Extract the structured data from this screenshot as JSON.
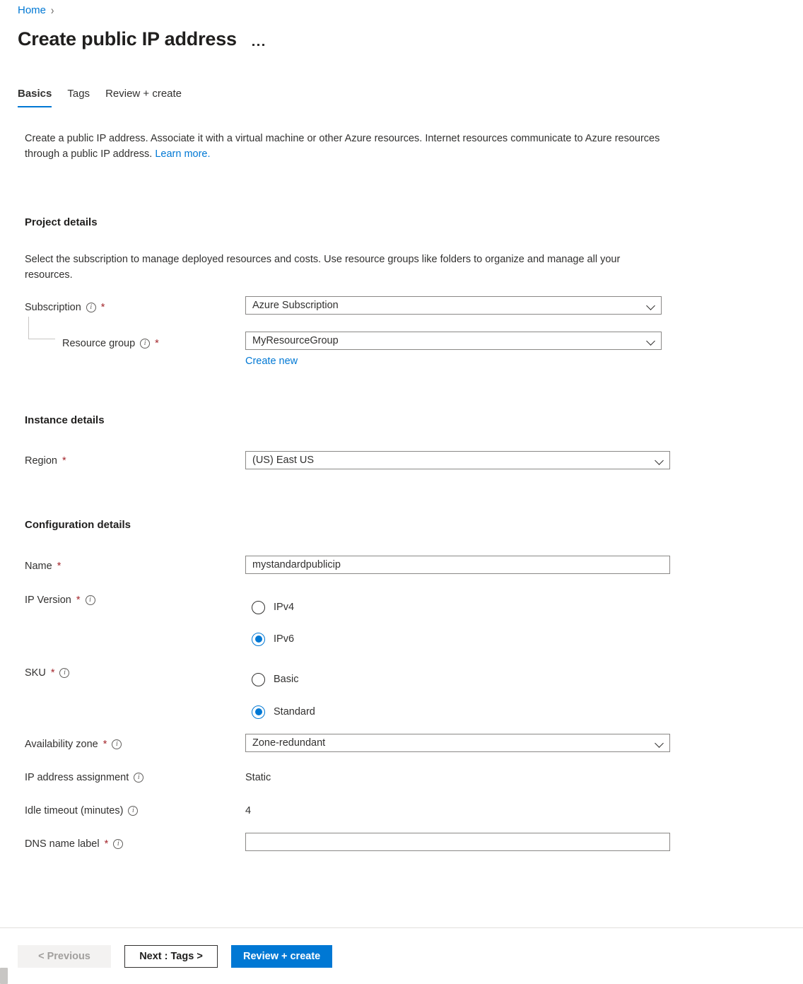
{
  "breadcrumb": {
    "home": "Home",
    "separator": "›"
  },
  "header": {
    "title": "Create public IP address",
    "more_menu": "more-options"
  },
  "tabs": [
    {
      "label": "Basics",
      "active": true
    },
    {
      "label": "Tags",
      "active": false
    },
    {
      "label": "Review + create",
      "active": false
    }
  ],
  "intro": {
    "text": "Create a public IP address. Associate it with a virtual machine or other Azure resources. Internet resources communicate to Azure resources through a public IP address. ",
    "link": "Learn more."
  },
  "project_details": {
    "heading": "Project details",
    "description": "Select the subscription to manage deployed resources and costs. Use resource groups like folders to organize and manage all your resources.",
    "subscription": {
      "label": "Subscription",
      "required": "*",
      "value": "Azure Subscription"
    },
    "resource_group": {
      "label": "Resource group",
      "required": "*",
      "value": "MyResourceGroup",
      "create_new": "Create new"
    }
  },
  "instance_details": {
    "heading": "Instance details",
    "region": {
      "label": "Region",
      "required": "*",
      "value": "(US) East US"
    }
  },
  "configuration_details": {
    "heading": "Configuration details",
    "name": {
      "label": "Name",
      "required": "*",
      "value": "mystandardpublicip",
      "placeholder": ""
    },
    "ip_version": {
      "label": "IP Version",
      "required": "*",
      "options": [
        {
          "label": "IPv4",
          "selected": false
        },
        {
          "label": "IPv6",
          "selected": true
        }
      ]
    },
    "sku": {
      "label": "SKU",
      "required": "*",
      "options": [
        {
          "label": "Basic",
          "selected": false
        },
        {
          "label": "Standard",
          "selected": true
        }
      ]
    },
    "availability_zone": {
      "label": "Availability zone",
      "required": "*",
      "value": "Zone-redundant"
    },
    "ip_address_assignment": {
      "label": "IP address assignment",
      "value": "Static"
    },
    "idle_timeout": {
      "label": "Idle timeout (minutes)",
      "value": "4"
    },
    "dns_name_label": {
      "label": "DNS name label",
      "required": "*",
      "value": "",
      "placeholder": ""
    }
  },
  "footer": {
    "previous": "< Previous",
    "next": "Next : Tags >",
    "review_create": "Review + create"
  },
  "icons": {
    "info": "i",
    "chevron_down": "chevron-down-icon"
  },
  "colors": {
    "accent": "#0078d4",
    "required_asterisk": "#a4262c",
    "border": "#8a8886",
    "disabled_bg": "#f3f2f1"
  }
}
